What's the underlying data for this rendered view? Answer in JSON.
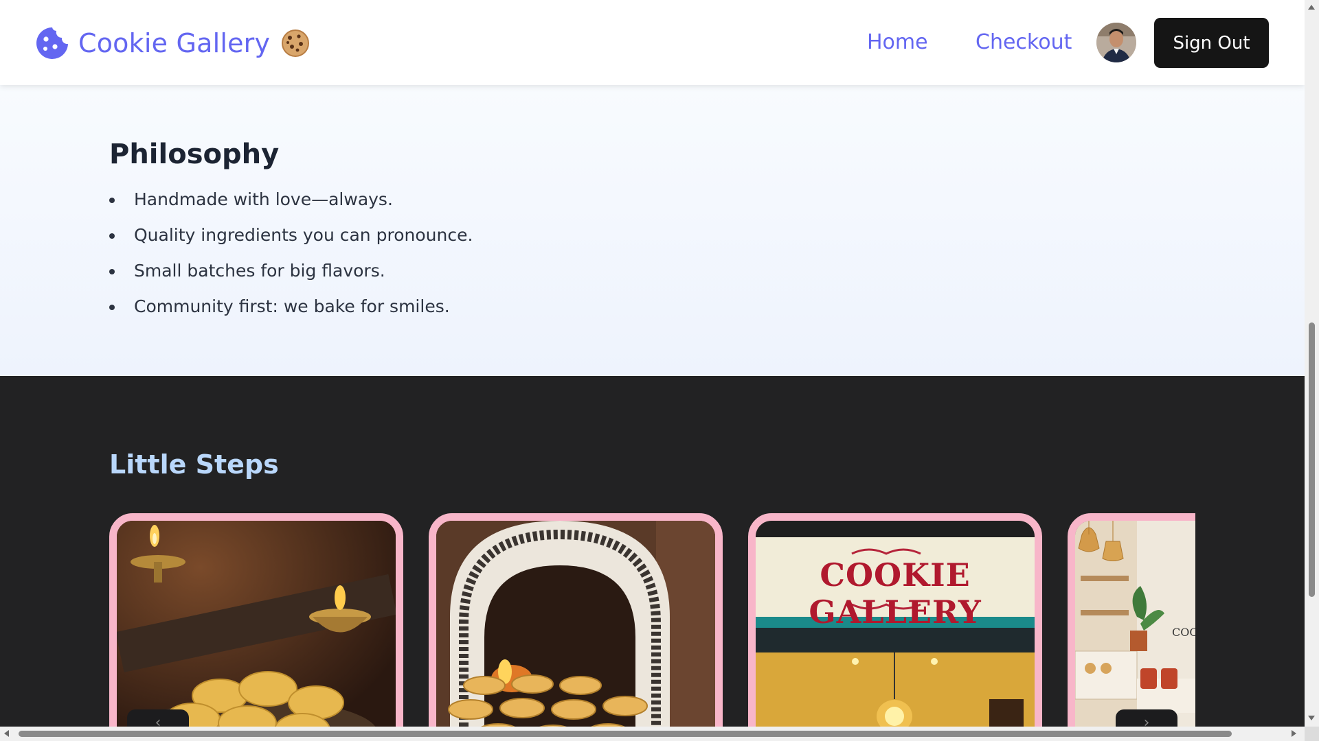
{
  "header": {
    "brand_name": "Cookie Gallery",
    "brand_icon": "cookie-icon",
    "brand_emoji": "cookie-emoji",
    "nav": [
      {
        "label": "Home"
      },
      {
        "label": "Checkout"
      }
    ],
    "sign_out_label": "Sign Out"
  },
  "philosophy": {
    "title": "Philosophy",
    "items": [
      "Handmade with love—always.",
      "Quality ingredients you can pronounce.",
      "Small batches for big flavors.",
      "Community first: we bake for smiles."
    ]
  },
  "steps": {
    "title": "Little Steps",
    "cards": [
      {
        "image": "cookies-with-diyas-photo"
      },
      {
        "image": "ornate-oven-photo"
      },
      {
        "image": "cookie-gallery-storefront-photo",
        "sign_text": "COOKIE GALLERY"
      },
      {
        "image": "bakery-interior-photo",
        "sign_text": "COO"
      }
    ]
  },
  "colors": {
    "brand": "#6366f1",
    "dark_section": "#222223",
    "card_border": "#f8b6c9",
    "steps_title": "#b9d7fb",
    "signout_bg": "#151515"
  }
}
